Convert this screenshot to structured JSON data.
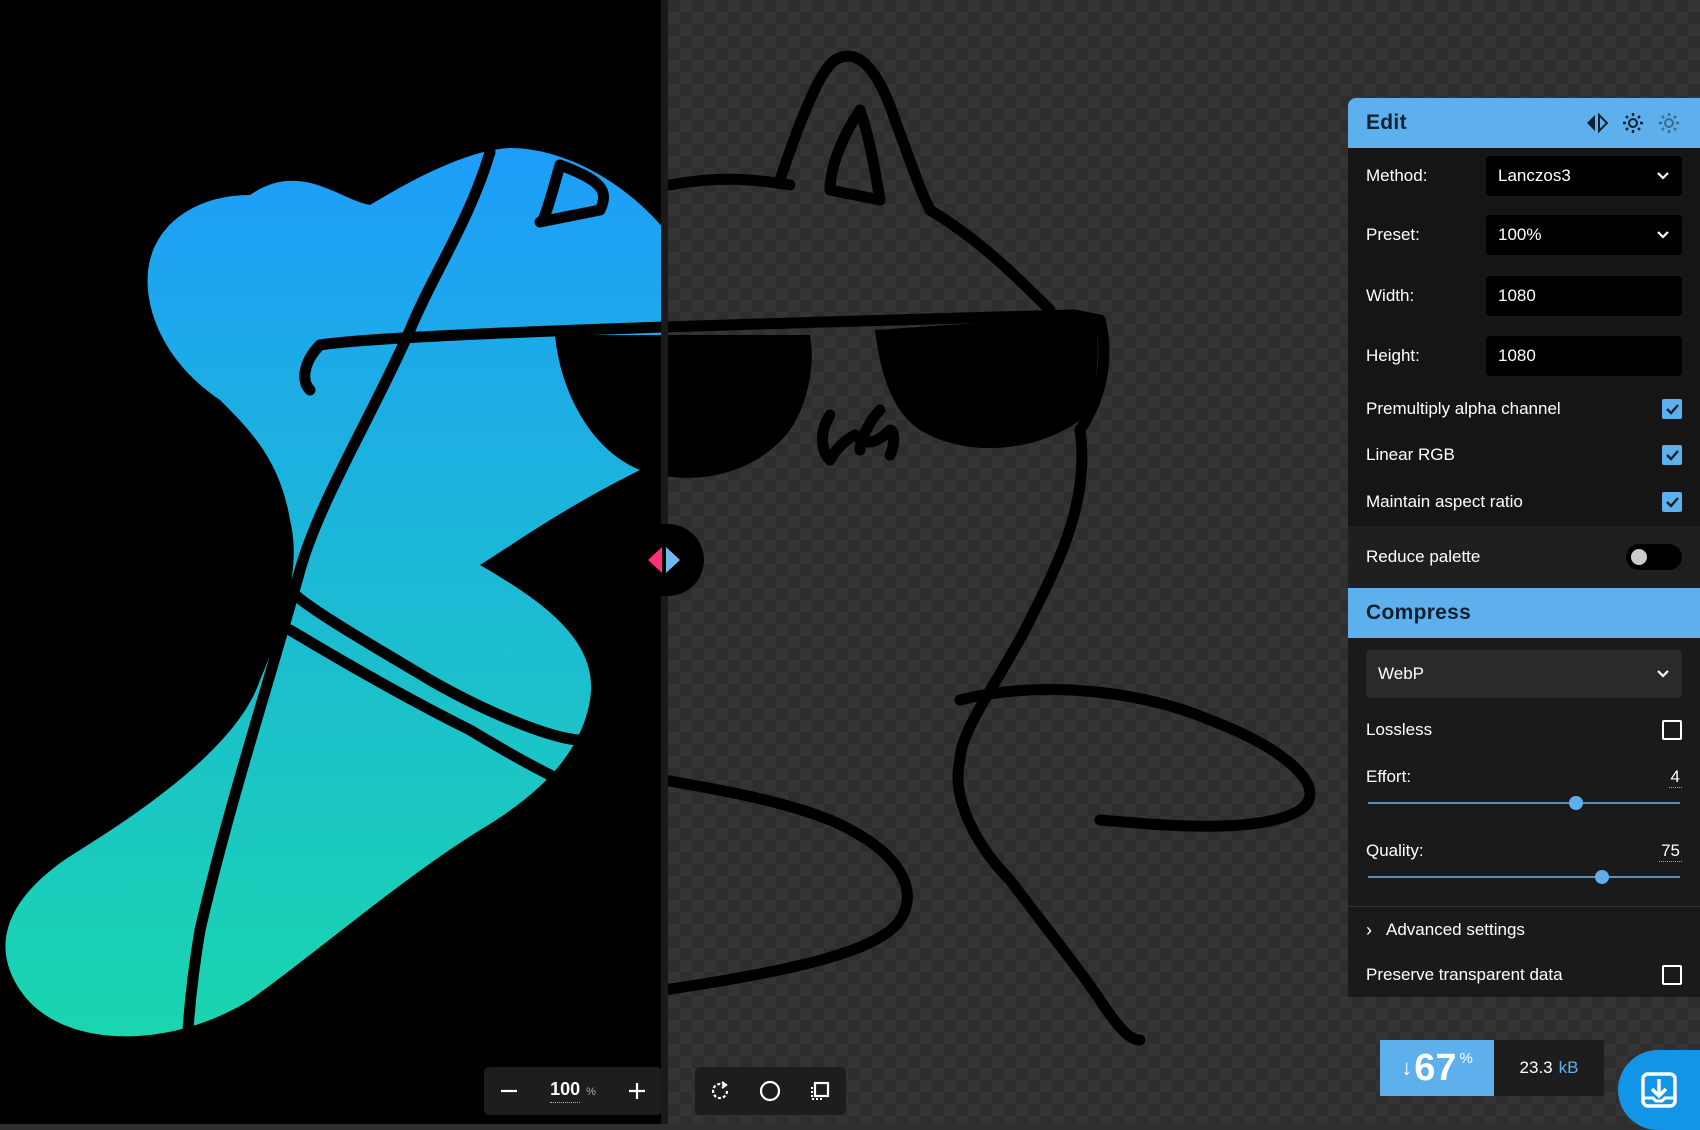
{
  "zoom": {
    "value": "100",
    "unit": "%"
  },
  "edit": {
    "title": "Edit",
    "method": {
      "label": "Method:",
      "value": "Lanczos3"
    },
    "preset": {
      "label": "Preset:",
      "value": "100%"
    },
    "width": {
      "label": "Width:",
      "value": "1080"
    },
    "height": {
      "label": "Height:",
      "value": "1080"
    },
    "premultiply": {
      "label": "Premultiply alpha channel",
      "checked": true
    },
    "linear_rgb": {
      "label": "Linear RGB",
      "checked": true
    },
    "aspect_ratio": {
      "label": "Maintain aspect ratio",
      "checked": true
    },
    "reduce_palette": {
      "label": "Reduce palette",
      "on": false
    }
  },
  "compress": {
    "title": "Compress",
    "format": "WebP",
    "lossless": {
      "label": "Lossless",
      "checked": false
    },
    "effort": {
      "label": "Effort:",
      "value": "4",
      "fraction": 0.6667
    },
    "quality": {
      "label": "Quality:",
      "value": "75",
      "fraction": 0.75
    },
    "advanced": {
      "label": "Advanced settings"
    },
    "preserve": {
      "label": "Preserve transparent data",
      "checked": false
    }
  },
  "result": {
    "savings_value": "67",
    "savings_unit": "%",
    "savings_arrow": "↓",
    "size_value": "23.3",
    "size_unit": "kB"
  },
  "icons": {
    "toolbar": [
      "minus-icon",
      "plus-icon",
      "rotate-icon",
      "circle-icon",
      "crop-icon"
    ],
    "header": [
      "compare-arrows-icon",
      "settings-import-icon",
      "settings-export-icon"
    ],
    "download": "download-icon"
  },
  "colors": {
    "accent": "#5eb0ec",
    "divider_left_arrow": "#ff2d7a",
    "gradient_top": "#1e9dfa",
    "gradient_bottom": "#1ad6ae"
  }
}
